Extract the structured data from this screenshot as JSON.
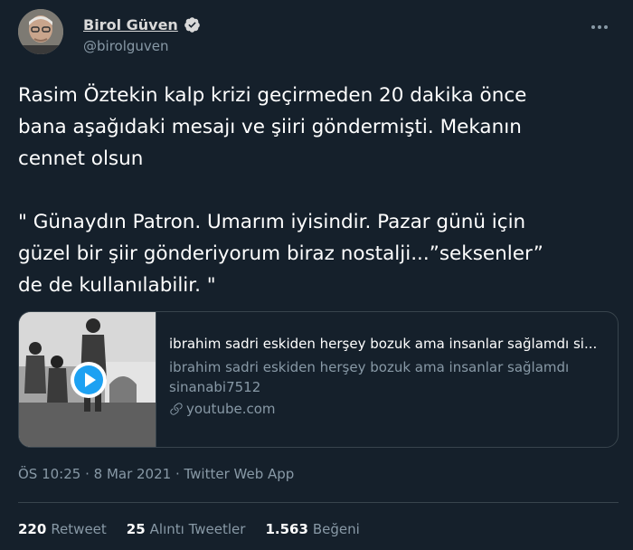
{
  "tweet": {
    "author": {
      "display_name": "Birol Güven",
      "handle": "@birolguven",
      "verified": true
    },
    "text": "Rasim Öztekin kalp krizi geçirmeden 20 dakika önce\nbana aşağıdaki mesajı ve şiiri göndermişti.  Mekanın\ncennet olsun\n\n\" Günaydın Patron. Umarım iyisindir. Pazar günü için\ngüzel bir şiir gönderiyorum biraz nostalji...”seksenler”\nde de kullanılabilir. \"",
    "link_card": {
      "title": "ibrahim sadri eskiden herşey bozuk ama insanlar sağlamdı si...",
      "description_line1": "ibrahim sadri eskiden herşey bozuk ama insanlar sağlamdı",
      "description_line2": "sinanabi7512",
      "domain": "youtube.com",
      "play_icon": "play-icon",
      "link_icon": "link-icon"
    },
    "meta": "ÖS 10:25 · 8 Mar 2021 · Twitter Web App",
    "stats": {
      "retweets": {
        "count": "220",
        "label": "Retweet"
      },
      "quotes": {
        "count": "25",
        "label": "Alıntı Tweetler"
      },
      "likes": {
        "count": "1.563",
        "label": "Beğeni"
      }
    }
  },
  "colors": {
    "background": "#15202b",
    "secondary_text": "#8899a6",
    "border": "#38444d",
    "accent": "#1da1f2"
  }
}
